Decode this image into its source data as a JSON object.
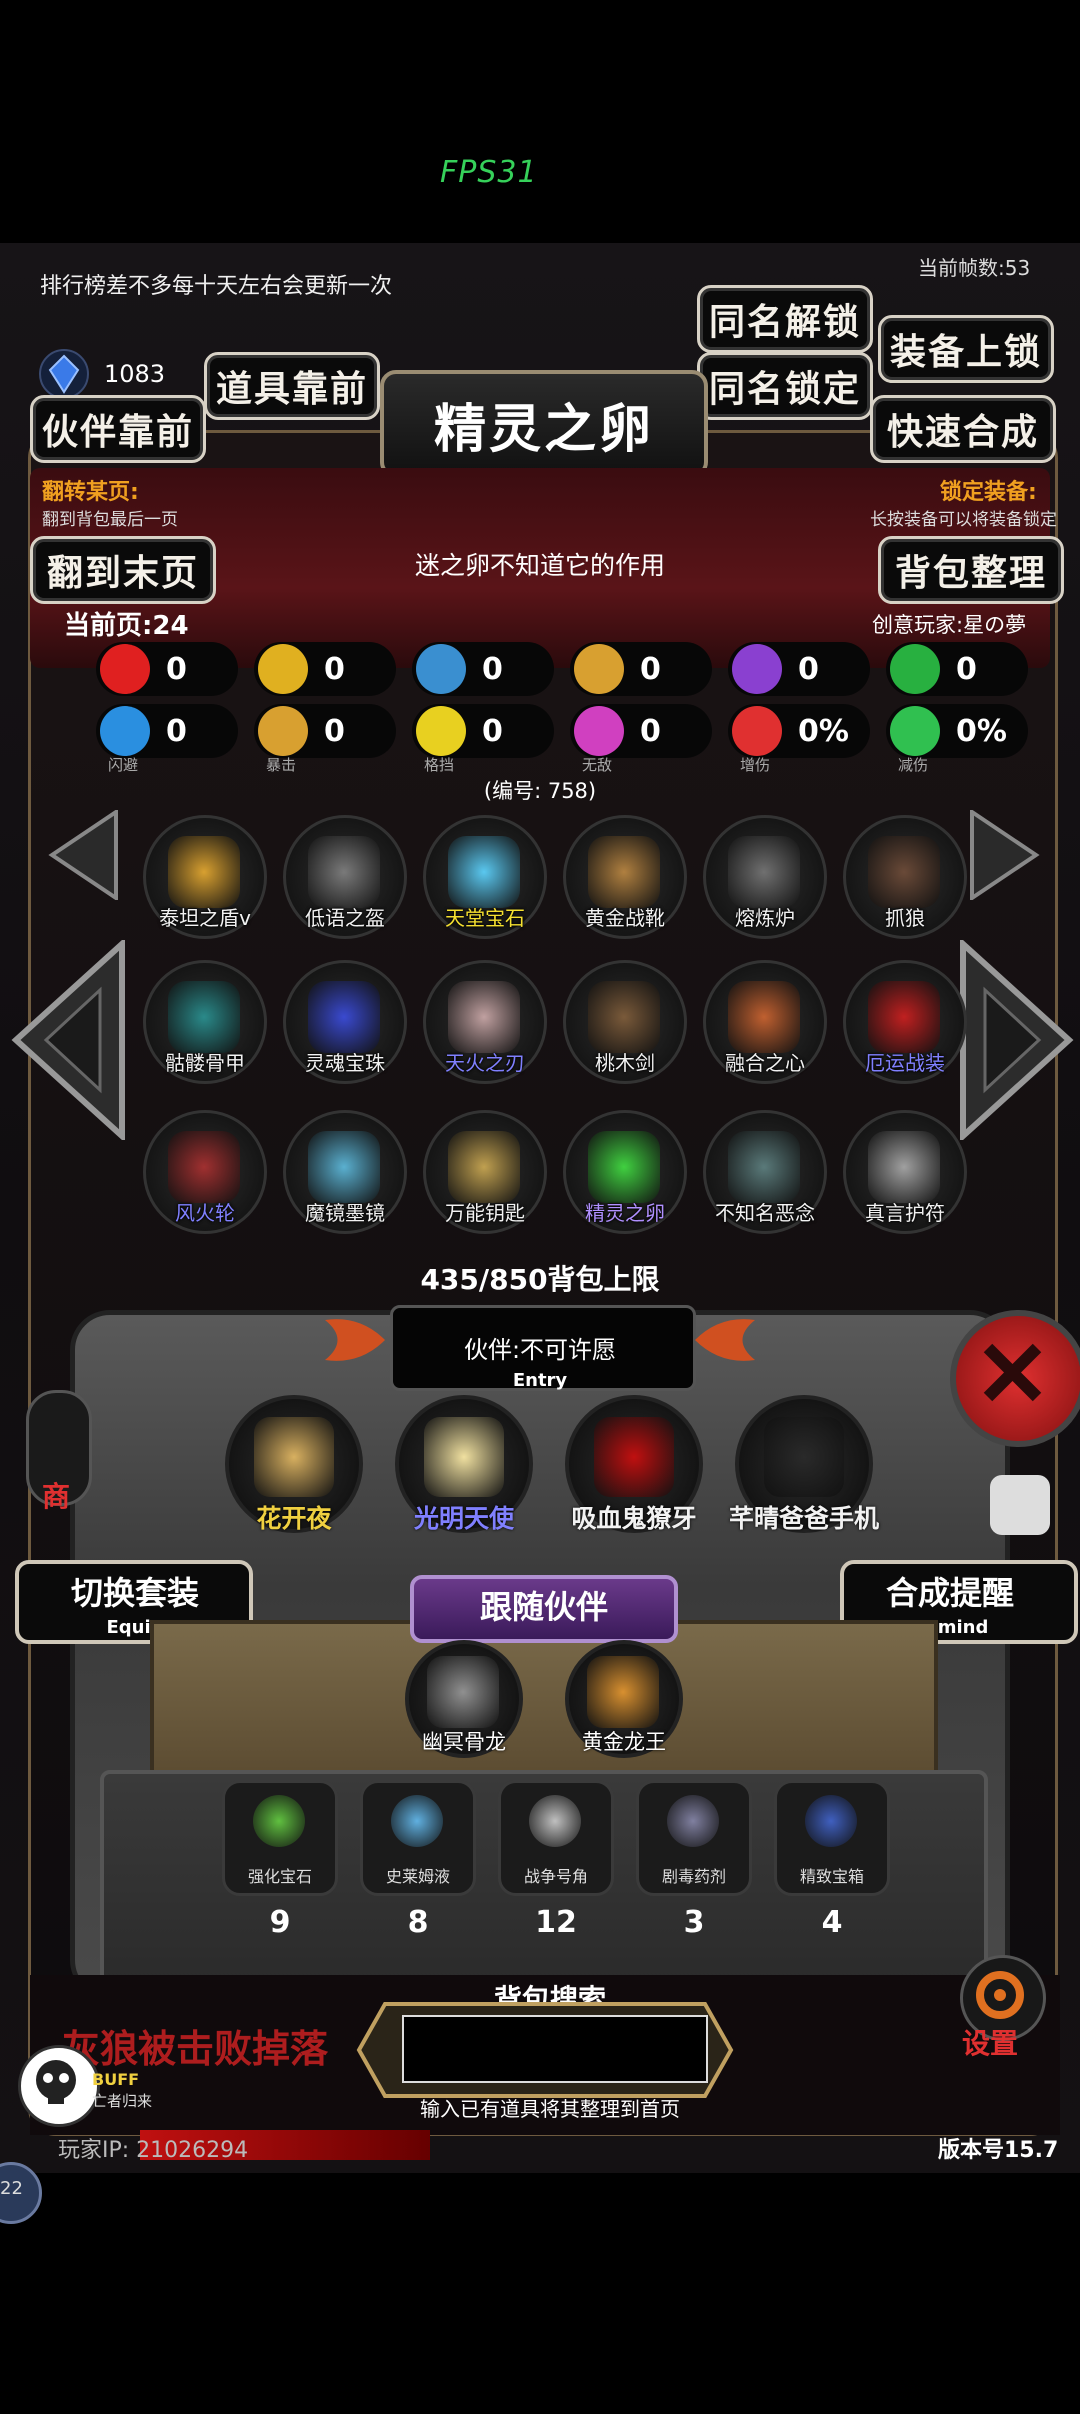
{
  "fps": "FPS31",
  "current_frame": "当前帧数:53",
  "notice": "排行榜差不多每十天左右会更新一次",
  "gem_count": "1083",
  "buttons": {
    "same_unlock": "同名解锁",
    "equip_lock": "装备上锁",
    "item_front": "道具靠前",
    "same_lock": "同名锁定",
    "partner_front": "伙伴靠前",
    "quick_merge": "快速合成",
    "to_last_page": "翻到末页",
    "bag_sort": "背包整理"
  },
  "title": "精灵之卵",
  "flip_page": {
    "label": "翻转某页:",
    "sub": "翻到背包最后一页"
  },
  "lock_equip": {
    "label": "锁定装备:",
    "sub": "长按装备可以将装备锁定"
  },
  "description": "迷之卵不知道它的作用",
  "current_page": "当前页:24",
  "creator": "创意玩家:星の夢",
  "stats_row1": [
    {
      "icon": "heart-icon",
      "value": "0",
      "color": "#e02020"
    },
    {
      "icon": "armor-icon",
      "value": "0",
      "color": "#e0b020"
    },
    {
      "icon": "helmet-icon",
      "value": "0",
      "color": "#3a8fd0"
    },
    {
      "icon": "sword-icon",
      "value": "0",
      "color": "#d8a030"
    },
    {
      "icon": "lightning-icon",
      "value": "0",
      "color": "#8a40d0"
    },
    {
      "icon": "clover-icon",
      "value": "0",
      "color": "#28b040"
    }
  ],
  "stats_row2": [
    {
      "icon": "dodge-icon",
      "value": "0",
      "label": "闪避",
      "color": "#2a8fe0"
    },
    {
      "icon": "crit-icon",
      "value": "0",
      "label": "暴击",
      "color": "#d8a030"
    },
    {
      "icon": "block-icon",
      "value": "0",
      "label": "格挡",
      "color": "#e8d020"
    },
    {
      "icon": "invincible-icon",
      "value": "0",
      "label": "无敌",
      "color": "#d040c0"
    },
    {
      "icon": "dmg-up-icon",
      "value": "0%",
      "label": "增伤",
      "color": "#e03030"
    },
    {
      "icon": "dmg-down-icon",
      "value": "0%",
      "label": "减伤",
      "color": "#30c050"
    }
  ],
  "item_code": "(编号: 758)",
  "items": [
    {
      "name": "泰坦之盾v",
      "color": "#d8a030",
      "namecolor": "#f2f2f2"
    },
    {
      "name": "低语之盔",
      "color": "#7a7a7a",
      "namecolor": "#f2f2f2"
    },
    {
      "name": "天堂宝石",
      "color": "#5ac8f0",
      "namecolor": "#f5e030"
    },
    {
      "name": "黄金战靴",
      "color": "#b08040",
      "namecolor": "#f2f2f2"
    },
    {
      "name": "熔炼炉",
      "color": "#707070",
      "namecolor": "#f2f2f2"
    },
    {
      "name": "抓狼",
      "color": "#6a4a38",
      "namecolor": "#f2f2f2"
    },
    {
      "name": "骷髅骨甲",
      "color": "#2a8a8a",
      "namecolor": "#f2f2f2"
    },
    {
      "name": "灵魂宝珠",
      "color": "#3a4ad0",
      "namecolor": "#f2f2f2"
    },
    {
      "name": "天火之刃",
      "color": "#c0a0a0",
      "namecolor": "#8080ff"
    },
    {
      "name": "桃木剑",
      "color": "#7a5a3a",
      "namecolor": "#f2f2f2"
    },
    {
      "name": "融合之心",
      "color": "#c06030",
      "namecolor": "#f2f2f2"
    },
    {
      "name": "厄运战装",
      "color": "#c02020",
      "namecolor": "#8080ff"
    },
    {
      "name": "风火轮",
      "color": "#a03030",
      "namecolor": "#8080ff"
    },
    {
      "name": "魔镜墨镜",
      "color": "#5ab0d0",
      "namecolor": "#f2f2f2"
    },
    {
      "name": "万能钥匙",
      "color": "#c0a050",
      "namecolor": "#f2f2f2"
    },
    {
      "name": "精灵之卵",
      "color": "#40d040",
      "namecolor": "#b090ff"
    },
    {
      "name": "不知名恶念",
      "color": "#5a7a7a",
      "namecolor": "#f2f2f2"
    },
    {
      "name": "真言护符",
      "color": "#a0a0a0",
      "namecolor": "#f2f2f2"
    }
  ],
  "capacity": "435/850背包上限",
  "partner_label": "伙伴:不可许愿",
  "entry": "Entry",
  "partners": [
    {
      "name": "花开夜",
      "color": "#d8b060",
      "namecolor": "#f0d040"
    },
    {
      "name": "光明天使",
      "color": "#f0e0a0",
      "namecolor": "#8080ff"
    },
    {
      "name": "吸血鬼獠牙",
      "color": "#c01010",
      "namecolor": "#f2f2f2"
    },
    {
      "name": "芊晴爸爸手机",
      "color": "#2a2a2a",
      "namecolor": "#f2f2f2"
    }
  ],
  "switch_set": {
    "label": "切换套装",
    "sub": "Equip"
  },
  "merge_remind": {
    "label": "合成提醒",
    "sub": "Remind"
  },
  "follow_partner": "跟随伙伴",
  "followers": [
    {
      "name": "幽冥骨龙",
      "color": "#909090"
    },
    {
      "name": "黄金龙王",
      "color": "#d89030"
    }
  ],
  "consumables": [
    {
      "name": "强化宝石",
      "count": "9",
      "color": "#60c040"
    },
    {
      "name": "史莱姆液",
      "count": "8",
      "color": "#60b0e0"
    },
    {
      "name": "战争号角",
      "count": "12",
      "color": "#c0c0c0"
    },
    {
      "name": "剧毒药剂",
      "count": "3",
      "color": "#8080a0"
    },
    {
      "name": "精致宝箱",
      "count": "4",
      "color": "#4060c0"
    }
  ],
  "bag_search": "背包搜索",
  "search_hint": "输入已有道具将其整理到首页",
  "defeat_text": "灰狼被击败掉落",
  "settings": "设置",
  "shop": "商",
  "player_ip": "玩家IP: 21026294",
  "version": "版本号15.7",
  "buff": "BUFF",
  "buff_sub": "亡者归来",
  "side_badge": "22"
}
